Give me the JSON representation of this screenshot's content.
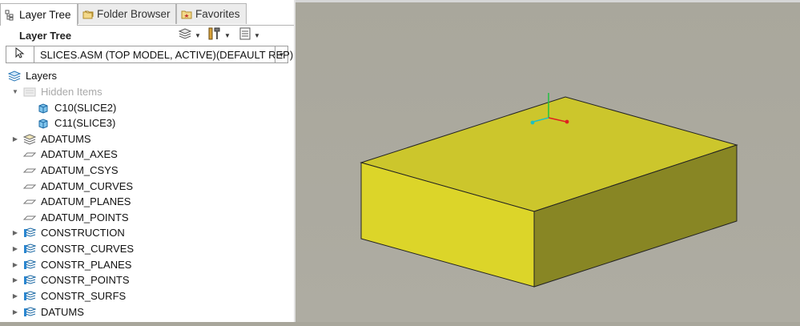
{
  "tabs": [
    {
      "label": "Layer Tree",
      "icon": "layer-tree-icon",
      "active": true
    },
    {
      "label": "Folder Browser",
      "icon": "folder-browser-icon",
      "active": false
    },
    {
      "label": "Favorites",
      "icon": "favorites-icon",
      "active": false
    }
  ],
  "toolbar": {
    "title": "Layer Tree",
    "layers_button_icon": "layers-icon",
    "settings_button_icon": "tools-icon",
    "show_button_icon": "list-icon"
  },
  "model_row": {
    "select_icon": "cursor-arrow-icon",
    "model_label": "SLICES.ASM (TOP MODEL, ACTIVE)(DEFAULT REP)"
  },
  "tree": [
    {
      "label": "Layers",
      "icon": "layers-icon",
      "expand": "",
      "indent": 0,
      "dim": false
    },
    {
      "label": "Hidden Items",
      "icon": "hidden-items-icon",
      "expand": "expanded",
      "indent": 1,
      "dim": true
    },
    {
      "label": "C10(SLICE2)",
      "icon": "part-cube-icon",
      "expand": "",
      "indent": 2,
      "dim": false
    },
    {
      "label": "C11(SLICE3)",
      "icon": "part-cube-icon",
      "expand": "",
      "indent": 2,
      "dim": false
    },
    {
      "label": "ADATUMS",
      "icon": "layer-stack-icon",
      "expand": "collapsed",
      "indent": 1,
      "dim": false
    },
    {
      "label": "ADATUM_AXES",
      "icon": "layer-plain-icon",
      "expand": "",
      "indent": 1,
      "dim": false
    },
    {
      "label": "ADATUM_CSYS",
      "icon": "layer-plain-icon",
      "expand": "",
      "indent": 1,
      "dim": false
    },
    {
      "label": "ADATUM_CURVES",
      "icon": "layer-plain-icon",
      "expand": "",
      "indent": 1,
      "dim": false
    },
    {
      "label": "ADATUM_PLANES",
      "icon": "layer-plain-icon",
      "expand": "",
      "indent": 1,
      "dim": false
    },
    {
      "label": "ADATUM_POINTS",
      "icon": "layer-plain-icon",
      "expand": "",
      "indent": 1,
      "dim": false
    },
    {
      "label": "CONSTRUCTION",
      "icon": "layer-blue-icon",
      "expand": "collapsed",
      "indent": 1,
      "dim": false
    },
    {
      "label": "CONSTR_CURVES",
      "icon": "layer-blue-icon",
      "expand": "collapsed",
      "indent": 1,
      "dim": false
    },
    {
      "label": "CONSTR_PLANES",
      "icon": "layer-blue-icon",
      "expand": "collapsed",
      "indent": 1,
      "dim": false
    },
    {
      "label": "CONSTR_POINTS",
      "icon": "layer-blue-icon",
      "expand": "collapsed",
      "indent": 1,
      "dim": false
    },
    {
      "label": "CONSTR_SURFS",
      "icon": "layer-blue-icon",
      "expand": "collapsed",
      "indent": 1,
      "dim": false
    },
    {
      "label": "DATUMS",
      "icon": "layer-blue-icon",
      "expand": "collapsed",
      "indent": 1,
      "dim": false
    }
  ],
  "viewport": {
    "background": "#a9a79c",
    "model_top_color": "#ccc62c",
    "model_front_color": "#dcd529",
    "model_side_color": "#888624",
    "csys_x_color": "#e02020",
    "csys_y_color": "#22c040",
    "csys_z_color": "#20c0c0"
  }
}
